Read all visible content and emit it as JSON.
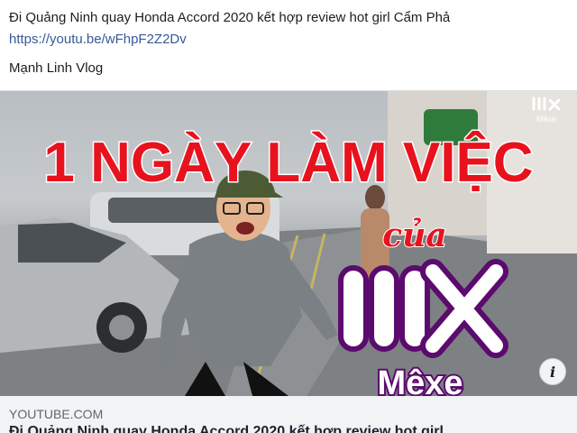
{
  "post": {
    "title": "Đi Quảng Ninh quay Honda Accord 2020 kết hợp review hot girl Cẩm Phả",
    "link": "https://youtu.be/wFhpF2Z2Dv",
    "author": "Mạnh Linh Vlog"
  },
  "thumbnail": {
    "headline": "1 NGÀY LÀM VIỆC",
    "sub": "của",
    "brand_caption": "Mêxe",
    "corner_caption": "Mêxe",
    "colors": {
      "headline_red": "#e8121e",
      "brand_purple": "#5b0a6e",
      "sky": "#c3c7ca"
    }
  },
  "link_preview": {
    "domain": "YOUTUBE.COM",
    "title": "Đi Quảng Ninh quay Honda Accord 2020 kết hợp review hot girl"
  },
  "icons": {
    "info": "info-icon"
  }
}
